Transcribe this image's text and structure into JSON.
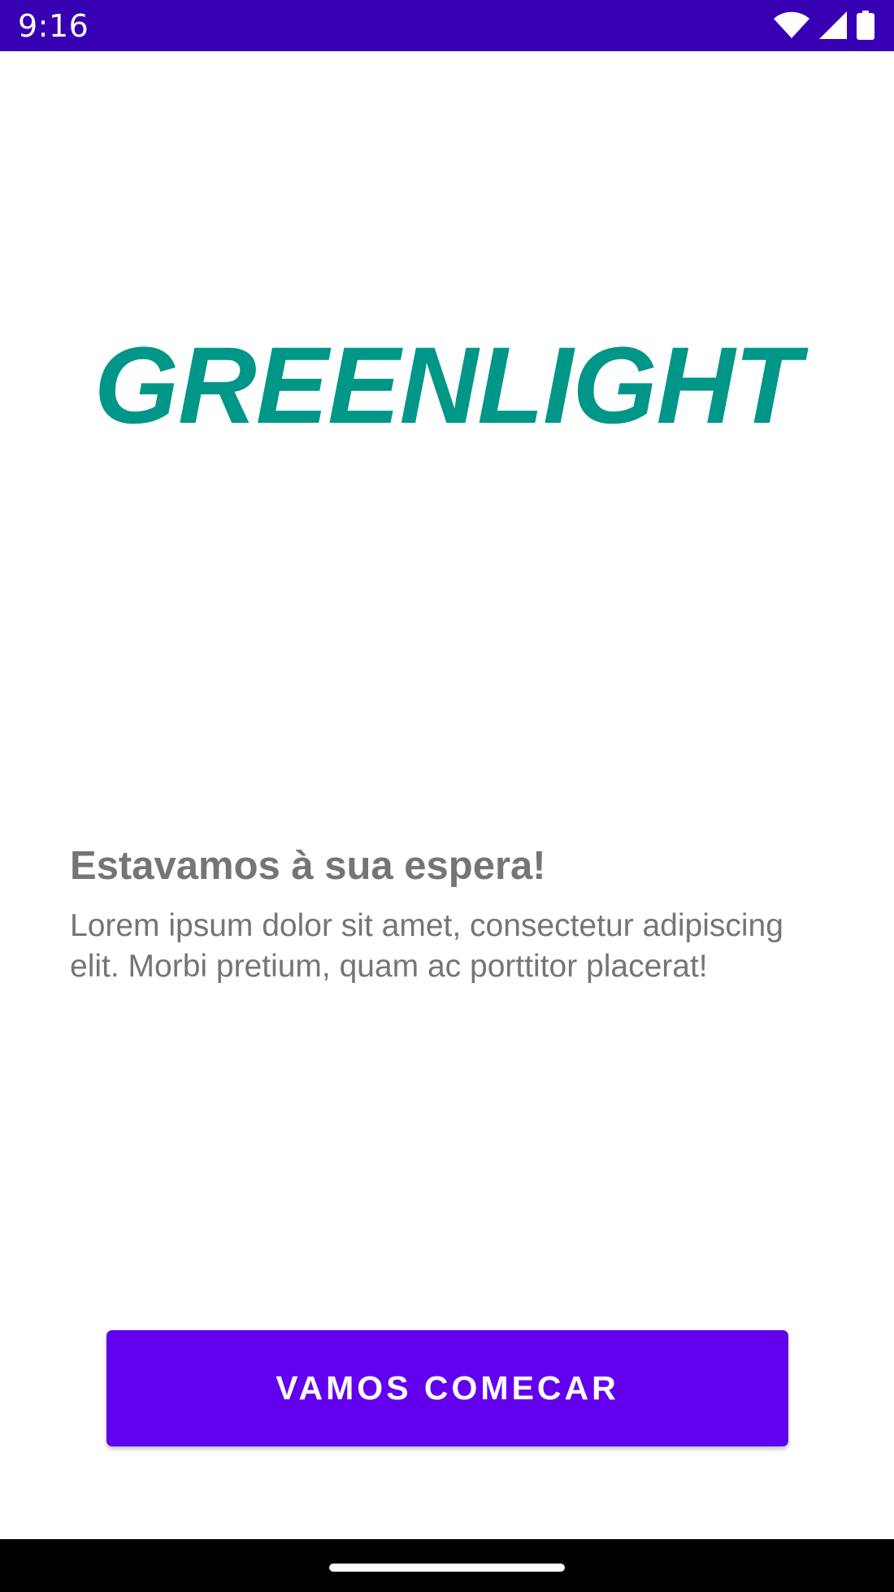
{
  "status_bar": {
    "time": "9:16",
    "background_color": "#3700b3",
    "icons": [
      "wifi-icon",
      "cell-signal-icon",
      "battery-icon"
    ]
  },
  "logo": {
    "text": "GREENLIGHT",
    "color": "#009688"
  },
  "welcome": {
    "title": "Estavamos à sua espera!",
    "body": "Lorem ipsum dolor sit amet, consectetur adipiscing elit. Morbi pretium, quam ac porttitor placerat!"
  },
  "cta": {
    "label": "VAMOS COMECAR",
    "color": "#6200ee"
  },
  "navigation_bar": {
    "icons": [
      "home-handle"
    ]
  }
}
